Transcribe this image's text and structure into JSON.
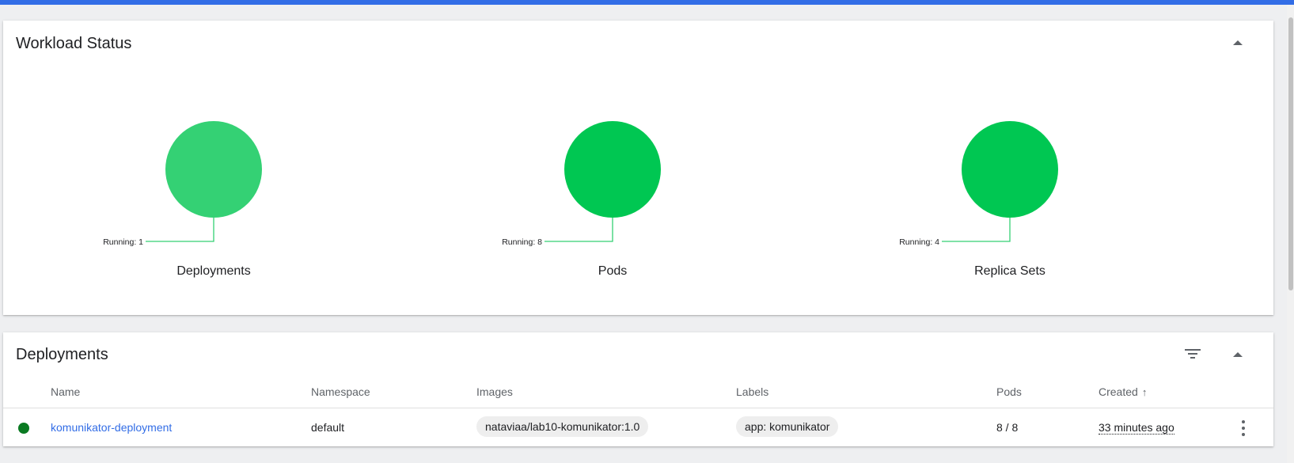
{
  "workload_status": {
    "title": "Workload Status",
    "charts": [
      {
        "name": "Deployments",
        "legend": "Running: 1",
        "running": 1,
        "color": "#34d174"
      },
      {
        "name": "Pods",
        "legend": "Running: 8",
        "running": 8,
        "color": "#00c752"
      },
      {
        "name": "Replica Sets",
        "legend": "Running: 4",
        "running": 4,
        "color": "#00c752"
      }
    ],
    "line_color": "#34d174"
  },
  "deployments": {
    "title": "Deployments",
    "columns": {
      "name": "Name",
      "namespace": "Namespace",
      "images": "Images",
      "labels": "Labels",
      "pods": "Pods",
      "created": "Created"
    },
    "sort_icon": "arrow-up-icon",
    "rows": [
      {
        "status": "running",
        "status_color": "#0a7a22",
        "name": "komunikator-deployment",
        "namespace": "default",
        "image": "nataviaa/lab10-komunikator:1.0",
        "label": "app: komunikator",
        "pods": "8 / 8",
        "created": "33 minutes ago"
      }
    ]
  },
  "icons": {
    "collapse": "chevron-up-icon",
    "filter": "filter-icon",
    "more": "more-vert-icon"
  },
  "colors": {
    "brand_bar": "#326de6",
    "link": "#326de6"
  }
}
